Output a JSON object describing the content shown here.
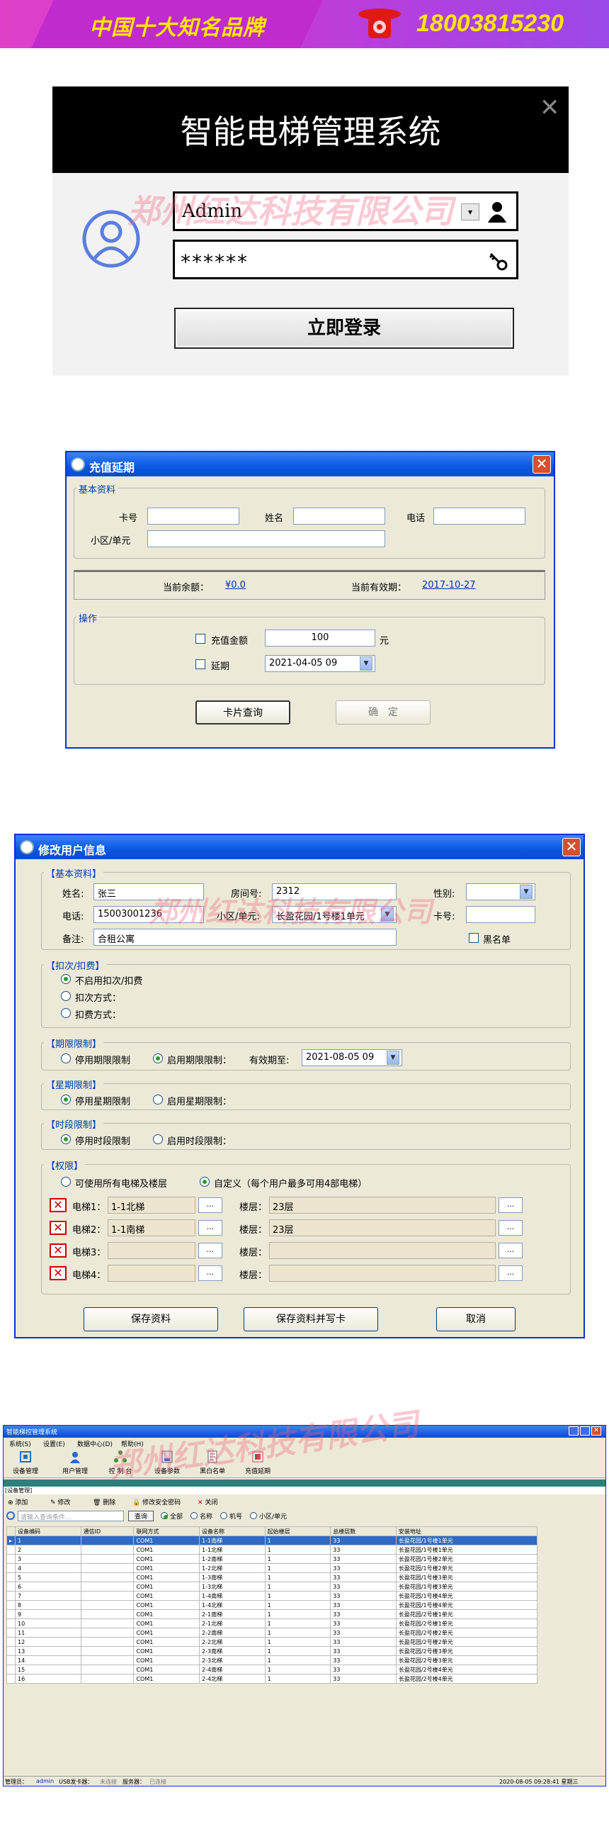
{
  "banner": {
    "brand": "中国十大知名品牌",
    "phone": "18003815230"
  },
  "watermark": "郑州红达科技有限公司",
  "login": {
    "title": "智能电梯管理系统",
    "username": "Admin",
    "password": "******",
    "login_button": "立即登录",
    "close": "✕"
  },
  "recharge": {
    "title": "充值延期",
    "basic_group": "基本资料",
    "card_label": "卡号",
    "name_label": "姓名",
    "phone_label": "电话",
    "community_label": "小区/单元",
    "balance_label": "当前余额：",
    "balance_value": "¥0.0",
    "expiry_label": "当前有效期：",
    "expiry_value": "2017-10-27",
    "ops_group": "操作",
    "recharge_label": "充值金额",
    "recharge_value": "100",
    "yuan": "元",
    "extend_label": "延期",
    "extend_value": "2021-04-05 09",
    "query_button": "卡片查询",
    "confirm_button": "确　定"
  },
  "edituser": {
    "title": "修改用户信息",
    "basic_group": "【基本资料】",
    "name_label": "姓名:",
    "name_value": "张三",
    "room_label": "房间号:",
    "room_value": "2312",
    "gender_label": "性别:",
    "phone_label": "电话:",
    "phone_value": "15003001236",
    "community_label": "小区/单元:",
    "community_value": "长盈花园/1号楼1单元",
    "card_label": "卡号:",
    "note_label": "备注:",
    "note_value": "合租公寓",
    "blacklist_label": "黑名单",
    "deduct_group": "【扣次/扣费】",
    "deduct_opts": [
      "不启用扣次/扣费",
      "扣次方式：",
      "扣费方式："
    ],
    "period_group": "【期限限制】",
    "period_off": "停用期限限制",
    "period_on": "启用期限限制：",
    "valid_label": "有效期至:",
    "valid_value": "2021-08-05 09",
    "week_group": "【星期限制】",
    "week_off": "停用星期限制",
    "week_on": "启用星期限制：",
    "time_group": "【时段限制】",
    "time_off": "停用时段限制",
    "time_on": "启用时段限制：",
    "perm_group": "【权限】",
    "perm_all": "可使用所有电梯及楼层",
    "perm_custom": "自定义（每个用户最多可用4部电梯）",
    "elevators": [
      {
        "label": "电梯1：",
        "value": "1-1北梯",
        "floor_label": "楼层：",
        "floor": "23层"
      },
      {
        "label": "电梯2：",
        "value": "1-1南梯",
        "floor_label": "楼层：",
        "floor": "23层"
      },
      {
        "label": "电梯3：",
        "value": "",
        "floor_label": "楼层：",
        "floor": ""
      },
      {
        "label": "电梯4：",
        "value": "",
        "floor_label": "楼层：",
        "floor": ""
      }
    ],
    "dots": "...",
    "save_button": "保存资料",
    "save_write_button": "保存资料并写卡",
    "cancel_button": "取消"
  },
  "manager": {
    "title": "智能梯控管理系统",
    "menu": [
      "系统(S)",
      "设置(E)",
      "数据中心(D)",
      "帮助(H)"
    ],
    "tools": [
      "设备管理",
      "用户管理",
      "控 制 台",
      "设备参数",
      "黑白名单",
      "充值延期"
    ],
    "section": "[设备管理]",
    "actions": [
      "添加",
      "修改",
      "删除",
      "修改安全密码",
      "关闭"
    ],
    "search_placeholder": "请输入查询条件...",
    "query": "查询",
    "filters": [
      "全部",
      "名称",
      "机号",
      "小区/单元"
    ],
    "columns": [
      "设备编码",
      "通信ID",
      "联网方式",
      "设备名称",
      "起始楼层",
      "总楼层数",
      "安装地址"
    ],
    "rows": [
      [
        "1",
        "",
        "COM1",
        "1-1南梯",
        "1",
        "33",
        "长盈花园/1号楼1单元"
      ],
      [
        "2",
        "",
        "COM1",
        "1-1北梯",
        "1",
        "33",
        "长盈花园/1号楼1单元"
      ],
      [
        "3",
        "",
        "COM1",
        "1-2南梯",
        "1",
        "33",
        "长盈花园/1号楼2单元"
      ],
      [
        "4",
        "",
        "COM1",
        "1-2北梯",
        "1",
        "33",
        "长盈花园/1号楼2单元"
      ],
      [
        "5",
        "",
        "COM1",
        "1-3南梯",
        "1",
        "33",
        "长盈花园/1号楼3单元"
      ],
      [
        "6",
        "",
        "COM1",
        "1-3北梯",
        "1",
        "33",
        "长盈花园/1号楼3单元"
      ],
      [
        "7",
        "",
        "COM1",
        "1-4南梯",
        "1",
        "33",
        "长盈花园/1号楼4单元"
      ],
      [
        "8",
        "",
        "COM1",
        "1-4北梯",
        "1",
        "33",
        "长盈花园/1号楼4单元"
      ],
      [
        "9",
        "",
        "COM1",
        "2-1南梯",
        "1",
        "33",
        "长盈花园/2号楼1单元"
      ],
      [
        "10",
        "",
        "COM1",
        "2-1北梯",
        "1",
        "33",
        "长盈花园/2号楼1单元"
      ],
      [
        "11",
        "",
        "COM1",
        "2-2南梯",
        "1",
        "33",
        "长盈花园/2号楼2单元"
      ],
      [
        "12",
        "",
        "COM1",
        "2-2北梯",
        "1",
        "33",
        "长盈花园/2号楼2单元"
      ],
      [
        "13",
        "",
        "COM1",
        "2-3南梯",
        "1",
        "33",
        "长盈花园/2号楼3单元"
      ],
      [
        "14",
        "",
        "COM1",
        "2-3北梯",
        "1",
        "33",
        "长盈花园/2号楼3单元"
      ],
      [
        "15",
        "",
        "COM1",
        "2-4南梯",
        "1",
        "33",
        "长盈花园/2号楼4单元"
      ],
      [
        "16",
        "",
        "COM1",
        "2-4北梯",
        "1",
        "33",
        "长盈花园/2号楼4单元"
      ]
    ],
    "status": {
      "admin_label": "管理员：",
      "admin": "admin",
      "usb_label": "USB发卡器：",
      "usb": "未连接",
      "server_label": "服务器：",
      "server": "已连接",
      "time": "2020-08-05 09:28:41 星期三"
    }
  }
}
